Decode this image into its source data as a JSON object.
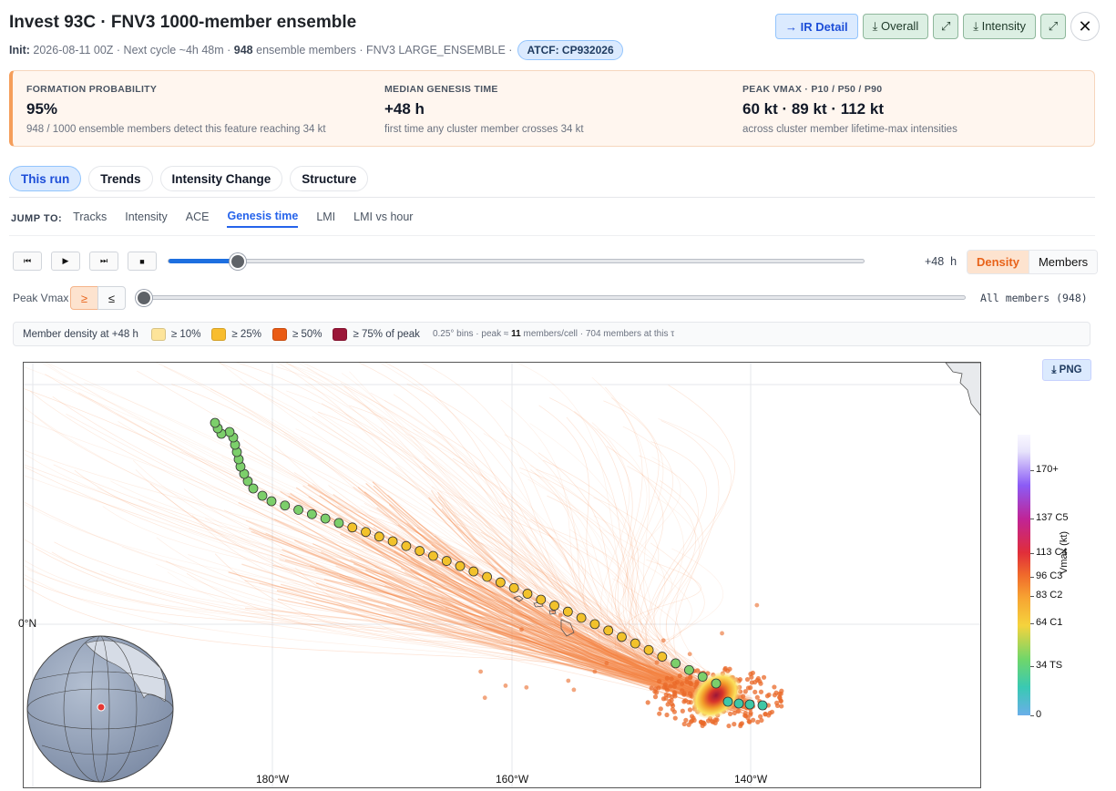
{
  "header": {
    "title": "Invest 93C · FNV3 1000-member ensemble",
    "init_label": "Init:",
    "init_value": "2026-08-11 00Z",
    "next_cycle": " · Next cycle ~4h 48m · ",
    "member_count": "948",
    "members_suffix": " ensemble members · FNV3 LARGE_ENSEMBLE ·",
    "atcf": "ATCF: CP932026",
    "buttons": {
      "ir_detail": "→ IR Detail",
      "overall": "⤓ Overall",
      "expand1": "⤢",
      "intensity": "⤓ Intensity",
      "expand2": "⤢",
      "close": "✕"
    }
  },
  "stats": [
    {
      "key": "FORMATION PROBABILITY",
      "value": "95%",
      "desc": "948 / 1000 ensemble members detect this feature reaching 34 kt"
    },
    {
      "key": "MEDIAN GENESIS TIME",
      "value": "+48 h",
      "desc": "first time any cluster member crosses 34 kt"
    },
    {
      "key": "PEAK VMAX · P10 / P50 / P90",
      "value": "60 kt · 89 kt · 112 kt",
      "desc": "across cluster member lifetime-max intensities"
    }
  ],
  "tabs": [
    "This run",
    "Trends",
    "Intensity Change",
    "Structure"
  ],
  "jump": {
    "label": "JUMP TO:",
    "items": [
      "Tracks",
      "Intensity",
      "ACE",
      "Genesis time",
      "LMI",
      "LMI vs hour"
    ],
    "active": "Genesis time"
  },
  "playback": {
    "buttons": [
      "⏮",
      "▶",
      "⏭",
      "■"
    ],
    "progress": 0.1,
    "time_value": "+48  h",
    "mode_on": "Density",
    "mode_off": "Members"
  },
  "vmax_filter": {
    "label": "Peak Vmax",
    "ge": "≥",
    "le": "≤",
    "value_text": "All members (948)",
    "progress": 0
  },
  "density_legend": {
    "title": "Member density at +48 h",
    "items": [
      {
        "label": "≥ 10%",
        "color": "#fde49a"
      },
      {
        "label": "≥ 25%",
        "color": "#f8bd2e"
      },
      {
        "label": "≥ 50%",
        "color": "#ea5b14"
      },
      {
        "label": "≥ 75% of peak",
        "color": "#9b1638"
      }
    ],
    "note_pre": "0.25° bins · peak ≈ ",
    "note_bold": "11",
    "note_post": " members/cell · 704 members at this τ"
  },
  "map": {
    "png_button": "⤓ PNG",
    "lon_labels": [
      "180°W",
      "160°W",
      "140°W"
    ],
    "lat_label": "0°N",
    "colorbar": {
      "title": "Vmax (kt)",
      "ticks": [
        {
          "label": "170+",
          "kt": 170
        },
        {
          "label": "137 C5",
          "kt": 137
        },
        {
          "label": "113 C4",
          "kt": 113
        },
        {
          "label": "96 C3",
          "kt": 96
        },
        {
          "label": "83 C2",
          "kt": 83
        },
        {
          "label": "64 C1",
          "kt": 64
        },
        {
          "label": "34 TS",
          "kt": 34
        },
        {
          "label": "0",
          "kt": 0
        }
      ]
    },
    "track_colors": {
      "td": "#7ccf6b",
      "ts": "#f2c22b",
      "genesis": "#3fc7a6",
      "spaghetti": "#f4813f"
    }
  }
}
